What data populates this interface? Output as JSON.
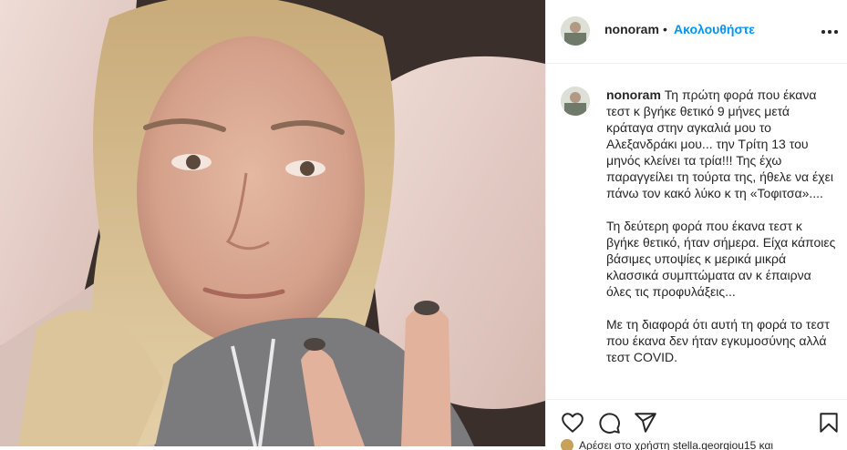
{
  "post": {
    "username": "nonoram",
    "separator": "•",
    "follow_label": "Ακολουθήστε",
    "more_icon": "more-horizontal-icon",
    "caption": {
      "username": "nonoram",
      "paragraph_1": "Τη πρώτη φορά που έκανα τεστ κ βγήκε θετικό 9 μήνες μετά κράταγα στην αγκαλιά μου το Αλεξανδράκι μου... την Τρίτη 13 του μηνός κλείνει τα τρία!!! Της έχω παραγγείλει τη τούρτα της, ήθελε να έχει πάνω τον κακό λύκο κ τη «Τοφιτσα»....",
      "paragraph_2": "Τη δεύτερη φορά που έκανα τεστ κ βγήκε θετικό, ήταν σήμερα. Είχα κάποιες βάσιμες υποψίες κ μερικά μικρά κλασσικά συμπτώματα αν κ έπαιρνα όλες τις προφυλάξεις...",
      "paragraph_3": "Με τη διαφορά ότι αυτή τη φορά το τεστ που έκανα δεν ήταν εγκυμοσύνης αλλά τεστ COVID."
    },
    "actions": {
      "like_icon": "heart-icon",
      "comment_icon": "comment-icon",
      "share_icon": "send-icon",
      "save_icon": "bookmark-icon"
    },
    "liked_by_partial": "Αρέσει στο χρήστη stella.georgiou15 και"
  },
  "colors": {
    "follow": "#0095f6",
    "text": "#262626",
    "border": "#efefef"
  }
}
